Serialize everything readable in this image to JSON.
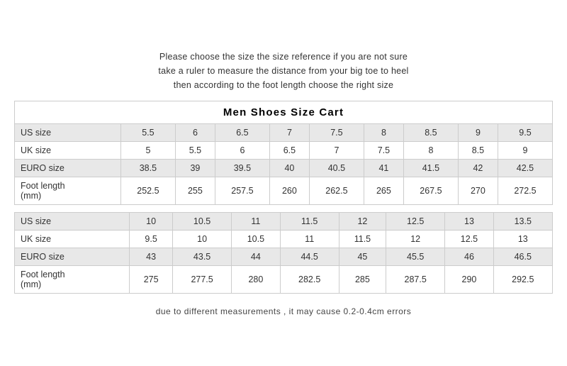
{
  "instructions": {
    "line1": "Please choose the size the size reference if you are not sure",
    "line2": "take a ruler to measure the distance from your big toe to heel",
    "line3": "then according to the foot length choose the right size"
  },
  "table1": {
    "header": "Men   Shoes   Size   Cart",
    "rows": [
      {
        "label": "US size",
        "values": [
          "5.5",
          "6",
          "6.5",
          "7",
          "7.5",
          "8",
          "8.5",
          "9",
          "9.5"
        ]
      },
      {
        "label": "UK size",
        "values": [
          "5",
          "5.5",
          "6",
          "6.5",
          "7",
          "7.5",
          "8",
          "8.5",
          "9"
        ]
      },
      {
        "label": "EURO size",
        "values": [
          "38.5",
          "39",
          "39.5",
          "40",
          "40.5",
          "41",
          "41.5",
          "42",
          "42.5"
        ]
      },
      {
        "label": "Foot length\n(mm)",
        "values": [
          "252.5",
          "255",
          "257.5",
          "260",
          "262.5",
          "265",
          "267.5",
          "270",
          "272.5"
        ]
      }
    ]
  },
  "table2": {
    "rows": [
      {
        "label": "US size",
        "values": [
          "10",
          "10.5",
          "11",
          "11.5",
          "12",
          "12.5",
          "13",
          "13.5"
        ]
      },
      {
        "label": "UK size",
        "values": [
          "9.5",
          "10",
          "10.5",
          "11",
          "11.5",
          "12",
          "12.5",
          "13"
        ]
      },
      {
        "label": "EURO size",
        "values": [
          "43",
          "43.5",
          "44",
          "44.5",
          "45",
          "45.5",
          "46",
          "46.5"
        ]
      },
      {
        "label": "Foot length\n(mm)",
        "values": [
          "275",
          "277.5",
          "280",
          "282.5",
          "285",
          "287.5",
          "290",
          "292.5"
        ]
      }
    ]
  },
  "footer": "due to different measurements , it may cause 0.2-0.4cm errors"
}
